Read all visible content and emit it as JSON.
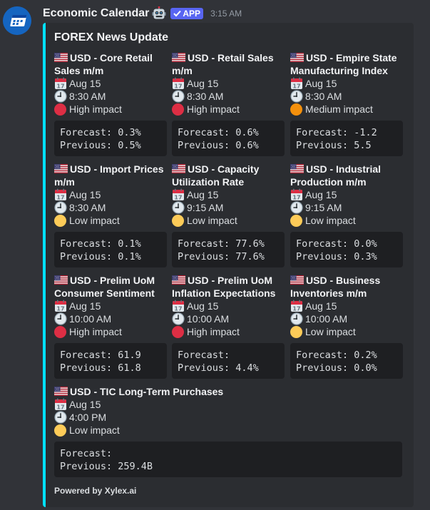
{
  "app": {
    "username": "Economic Calendar",
    "badge": "APP",
    "timestamp": "3:15 AM"
  },
  "embed": {
    "accent_color": "#00e1ff",
    "title": "FOREX News Update",
    "footer": "Powered by Xylex.ai",
    "events": [
      {
        "name": "USD - Core Retail Sales m/m",
        "date": "Aug 15",
        "time": "8:30 AM",
        "impact": "High impact",
        "impact_color": "#dd2e44",
        "forecast": "Forecast: 0.3%",
        "previous": "Previous: 0.5%"
      },
      {
        "name": "USD - Retail Sales m/m",
        "date": "Aug 15",
        "time": "8:30 AM",
        "impact": "High impact",
        "impact_color": "#dd2e44",
        "forecast": "Forecast: 0.6%",
        "previous": "Previous: 0.6%"
      },
      {
        "name": "USD - Empire State Manufacturing Index",
        "date": "Aug 15",
        "time": "8:30 AM",
        "impact": "Medium impact",
        "impact_color": "#f4900c",
        "forecast": "Forecast: -1.2",
        "previous": "Previous: 5.5"
      },
      {
        "name": "USD - Import Prices m/m",
        "date": "Aug 15",
        "time": "8:30 AM",
        "impact": "Low impact",
        "impact_color": "#fdcb58",
        "forecast": "Forecast: 0.1%",
        "previous": "Previous: 0.1%"
      },
      {
        "name": "USD - Capacity Utilization Rate",
        "date": "Aug 15",
        "time": "9:15 AM",
        "impact": "Low impact",
        "impact_color": "#fdcb58",
        "forecast": "Forecast: 77.6%",
        "previous": "Previous: 77.6%"
      },
      {
        "name": "USD - Industrial Production m/m",
        "date": "Aug 15",
        "time": "9:15 AM",
        "impact": "Low impact",
        "impact_color": "#fdcb58",
        "forecast": "Forecast: 0.0%",
        "previous": "Previous: 0.3%"
      },
      {
        "name": "USD - Prelim UoM Consumer Sentiment",
        "date": "Aug 15",
        "time": "10:00 AM",
        "impact": "High impact",
        "impact_color": "#dd2e44",
        "forecast": "Forecast: 61.9",
        "previous": "Previous: 61.8"
      },
      {
        "name": "USD - Prelim UoM Inflation Expectations",
        "date": "Aug 15",
        "time": "10:00 AM",
        "impact": "High impact",
        "impact_color": "#dd2e44",
        "forecast": "Forecast:",
        "previous": "Previous: 4.4%"
      },
      {
        "name": "USD - Business Inventories m/m",
        "date": "Aug 15",
        "time": "10:00 AM",
        "impact": "Low impact",
        "impact_color": "#fdcb58",
        "forecast": "Forecast: 0.2%",
        "previous": "Previous: 0.0%"
      },
      {
        "name": "USD - TIC Long-Term Purchases",
        "date": "Aug 15",
        "time": "4:00 PM",
        "impact": "Low impact",
        "impact_color": "#fdcb58",
        "forecast": "Forecast:",
        "previous": "Previous: 259.4B"
      }
    ]
  }
}
